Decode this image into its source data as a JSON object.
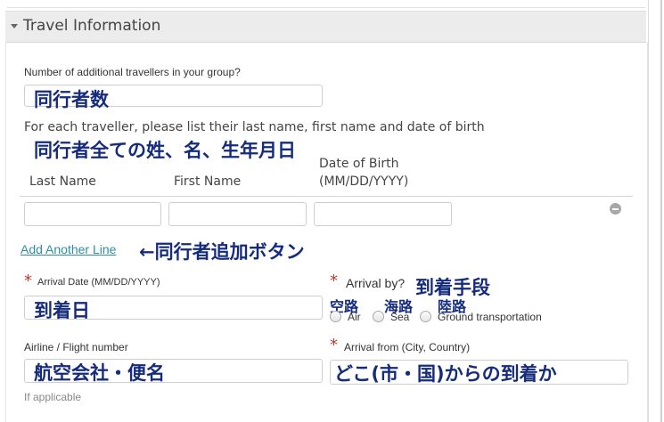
{
  "section": {
    "title": "Travel Information"
  },
  "travellers": {
    "count_label": "Number of additional travellers in your group?",
    "count_note": "同行者数",
    "instruction": "For each traveller, please list their last name, first name and date of birth",
    "instruction_note": "同行者全ての姓、名、生年月日",
    "columns": {
      "last_name": "Last Name",
      "first_name": "First Name",
      "dob_line1": "Date of Birth",
      "dob_line2": "(MM/DD/YYYY)"
    },
    "add_line": "Add Another Line",
    "add_line_note": "←同行者追加ボタン"
  },
  "arrival_date": {
    "label": "Arrival Date (MM/DD/YYYY)",
    "note": "到着日"
  },
  "arrival_by": {
    "label": "Arrival by?",
    "note": "到着手段",
    "options": [
      {
        "label": "Air",
        "note": "空路"
      },
      {
        "label": "Sea",
        "note": "海路"
      },
      {
        "label": "Ground transportation",
        "note": "陸路"
      }
    ]
  },
  "airline": {
    "label": "Airline / Flight number",
    "note": "航空会社・便名",
    "hint": "If applicable"
  },
  "arrival_from": {
    "label": "Arrival from (City, Country)",
    "note": "どこ(市・国)からの到着か"
  }
}
